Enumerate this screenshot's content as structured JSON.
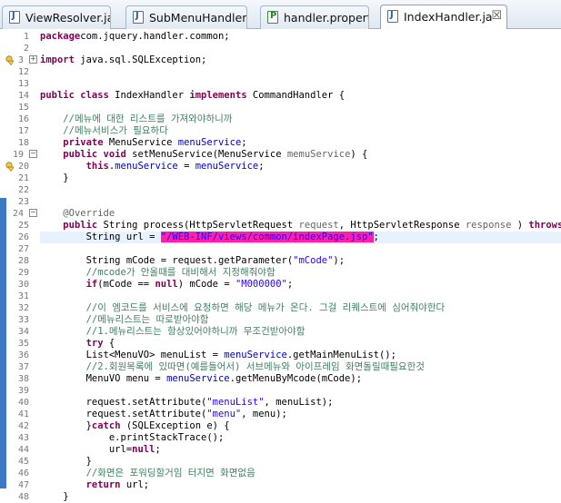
{
  "tabs": [
    {
      "label": "ViewResolver.ja",
      "icon": "java-file-icon"
    },
    {
      "label": "SubMenuHandler.",
      "icon": "java-file-icon"
    },
    {
      "label": "handler.propert",
      "icon": "properties-file-icon"
    },
    {
      "label": "IndexHandler.ja",
      "icon": "java-file-icon",
      "active": true,
      "close": "☒"
    }
  ],
  "lines": [
    {
      "n": "1",
      "parts": [
        [
          "kw",
          "package"
        ],
        [
          "",
          "com.jquery.handler.common;"
        ]
      ]
    },
    {
      "n": "2",
      "parts": []
    },
    {
      "n": "3",
      "fold": "+",
      "warn": true,
      "parts": [
        [
          "kw",
          "import"
        ],
        [
          "",
          " java.sql.SQLException;"
        ]
      ]
    },
    {
      "n": "12",
      "parts": []
    },
    {
      "n": "13",
      "parts": []
    },
    {
      "n": "14",
      "parts": [
        [
          "kw",
          "public class"
        ],
        [
          "",
          " IndexHandler "
        ],
        [
          "kw",
          "implements"
        ],
        [
          "",
          " CommandHandler {"
        ]
      ]
    },
    {
      "n": "15",
      "parts": []
    },
    {
      "n": "16",
      "parts": [
        [
          "",
          "    "
        ],
        [
          "cm",
          "//메뉴에 대한 리스트를 가져와야하니까"
        ]
      ]
    },
    {
      "n": "17",
      "parts": [
        [
          "",
          "    "
        ],
        [
          "cm",
          "//메뉴서비스가 필요하다"
        ]
      ]
    },
    {
      "n": "18",
      "parts": [
        [
          "",
          "    "
        ],
        [
          "kw",
          "private"
        ],
        [
          "",
          " MenuService "
        ],
        [
          "fd",
          "menuService"
        ],
        [
          "",
          ";"
        ]
      ]
    },
    {
      "n": "19",
      "fold": "−",
      "parts": [
        [
          "",
          "    "
        ],
        [
          "kw",
          "public void"
        ],
        [
          "",
          " setMenuService(MenuService "
        ],
        [
          "an",
          "memuService"
        ],
        [
          "",
          ") {"
        ]
      ]
    },
    {
      "n": "20",
      "warn": true,
      "parts": [
        [
          "",
          "        "
        ],
        [
          "kw",
          "this"
        ],
        [
          "",
          "."
        ],
        [
          "fd",
          "menuService"
        ],
        [
          "",
          " = "
        ],
        [
          "fd",
          "menuService"
        ],
        [
          "",
          ";"
        ]
      ]
    },
    {
      "n": "21",
      "parts": [
        [
          "",
          "    }"
        ]
      ]
    },
    {
      "n": "22",
      "parts": []
    },
    {
      "n": "23",
      "parts": []
    },
    {
      "n": "24",
      "fold": "−",
      "parts": [
        [
          "",
          "    "
        ],
        [
          "an",
          "@Override"
        ]
      ]
    },
    {
      "n": "25",
      "parts": [
        [
          "",
          "    "
        ],
        [
          "kw",
          "public"
        ],
        [
          "",
          " String process(HttpServletRequest "
        ],
        [
          "an",
          "request"
        ],
        [
          "",
          ", HttpServletResponse "
        ],
        [
          "an",
          "response"
        ],
        [
          "",
          " ) "
        ],
        [
          "kw",
          "throws"
        ],
        [
          "",
          " Ex"
        ]
      ]
    },
    {
      "n": "26",
      "hl": true,
      "parts": [
        [
          "",
          "        String url = "
        ],
        [
          "mark",
          "\"/WEB-INF/views/common/indexPage.jsp\""
        ],
        [
          "",
          ";"
        ]
      ]
    },
    {
      "n": "27",
      "parts": []
    },
    {
      "n": "28",
      "parts": [
        [
          "",
          "        String mCode = request.getParameter("
        ],
        [
          "st",
          "\"mCode\""
        ],
        [
          "",
          ");"
        ]
      ]
    },
    {
      "n": "29",
      "parts": [
        [
          "",
          "        "
        ],
        [
          "cm",
          "//mcode가 안올때를 대비해서 지정해줘야함"
        ]
      ]
    },
    {
      "n": "30",
      "parts": [
        [
          "",
          "        "
        ],
        [
          "kw",
          "if"
        ],
        [
          "",
          "(mCode == "
        ],
        [
          "kw",
          "null"
        ],
        [
          "",
          ") mCode = "
        ],
        [
          "st",
          "\"M000000\""
        ],
        [
          "",
          ";"
        ]
      ]
    },
    {
      "n": "31",
      "parts": []
    },
    {
      "n": "32",
      "parts": [
        [
          "",
          "        "
        ],
        [
          "cm",
          "//이 엠코드를 서비스에 요청하면 해당 메뉴가 온다. 그걸 리퀘스트에 심어줘야한다"
        ]
      ]
    },
    {
      "n": "33",
      "parts": [
        [
          "",
          "        "
        ],
        [
          "cm",
          "//메뉴리스트는 따로받아야함"
        ]
      ]
    },
    {
      "n": "34",
      "parts": [
        [
          "",
          "        "
        ],
        [
          "cm",
          "//1.메뉴리스트는 항상있어야하니까 무조건받아야함"
        ]
      ]
    },
    {
      "n": "35",
      "parts": [
        [
          "",
          "        "
        ],
        [
          "kw",
          "try"
        ],
        [
          "",
          " {"
        ]
      ]
    },
    {
      "n": "36",
      "parts": [
        [
          "",
          "        List<MenuVO> menuList = "
        ],
        [
          "fd",
          "menuService"
        ],
        [
          "",
          ".getMainMenuList();"
        ]
      ]
    },
    {
      "n": "37",
      "parts": [
        [
          "",
          "        "
        ],
        [
          "cm",
          "//2.회원목록에 있따면(예를들어서) 서브메뉴와 아이프레임 화면돌릴때필요한것"
        ]
      ]
    },
    {
      "n": "38",
      "parts": [
        [
          "",
          "        MenuVO menu = "
        ],
        [
          "fd",
          "menuService"
        ],
        [
          "",
          ".getMenuByMcode(mCode);"
        ]
      ]
    },
    {
      "n": "39",
      "parts": []
    },
    {
      "n": "40",
      "parts": [
        [
          "",
          "        request.setAttribute("
        ],
        [
          "st",
          "\"menuList\""
        ],
        [
          "",
          ", menuList);"
        ]
      ]
    },
    {
      "n": "41",
      "parts": [
        [
          "",
          "        request.setAttribute("
        ],
        [
          "st",
          "\"menu\""
        ],
        [
          "",
          ", menu);"
        ]
      ]
    },
    {
      "n": "42",
      "parts": [
        [
          "",
          "        }"
        ],
        [
          "kw",
          "catch"
        ],
        [
          "",
          " (SQLException e) {"
        ]
      ]
    },
    {
      "n": "43",
      "parts": [
        [
          "",
          "            e.printStackTrace();"
        ]
      ]
    },
    {
      "n": "44",
      "parts": [
        [
          "",
          "            url="
        ],
        [
          "kw",
          "null"
        ],
        [
          "",
          ";"
        ]
      ]
    },
    {
      "n": "45",
      "parts": [
        [
          "",
          "        }"
        ]
      ]
    },
    {
      "n": "46",
      "parts": [
        [
          "",
          "        "
        ],
        [
          "cm",
          "//화면은 포워딩할거임 터지면 화면없음"
        ]
      ]
    },
    {
      "n": "47",
      "parts": [
        [
          "",
          "        "
        ],
        [
          "kw",
          "return"
        ],
        [
          "",
          " url;"
        ]
      ]
    },
    {
      "n": "48",
      "parts": [
        [
          "",
          "    }"
        ]
      ]
    }
  ]
}
